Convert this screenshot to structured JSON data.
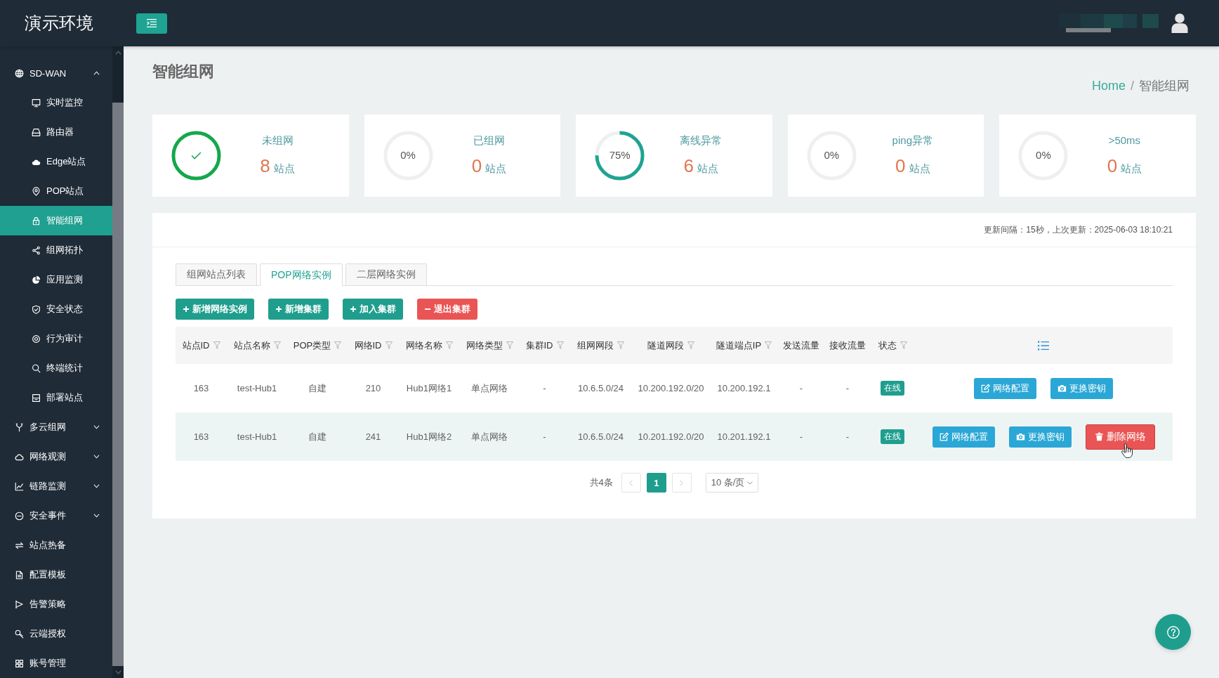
{
  "app": {
    "title": "演示环境"
  },
  "sidebar": {
    "items": [
      {
        "label": "SD-WAN",
        "selected": false,
        "expanded": true,
        "children": [
          {
            "label": "实时监控",
            "selected": false
          },
          {
            "label": "路由器",
            "selected": false
          },
          {
            "label": "Edge站点",
            "selected": false
          },
          {
            "label": "POP站点",
            "selected": false
          },
          {
            "label": "智能组网",
            "selected": true
          },
          {
            "label": "组网拓扑",
            "selected": false
          },
          {
            "label": "应用监测",
            "selected": false
          },
          {
            "label": "安全状态",
            "selected": false
          },
          {
            "label": "行为审计",
            "selected": false
          },
          {
            "label": "终端统计",
            "selected": false
          },
          {
            "label": "部署站点",
            "selected": false
          }
        ]
      },
      {
        "label": "多云组网",
        "selected": false,
        "expanded": false
      },
      {
        "label": "网络观测",
        "selected": false,
        "expanded": false
      },
      {
        "label": "链路监测",
        "selected": false,
        "expanded": false
      },
      {
        "label": "安全事件",
        "selected": false,
        "expanded": false
      },
      {
        "label": "站点热备",
        "selected": false
      },
      {
        "label": "配置模板",
        "selected": false
      },
      {
        "label": "告警策略",
        "selected": false
      },
      {
        "label": "云端授权",
        "selected": false
      },
      {
        "label": "账号管理",
        "selected": false
      }
    ]
  },
  "page": {
    "title": "智能组网",
    "breadcrumb": {
      "items": [
        "Home",
        "智能组网"
      ],
      "separator": "/"
    }
  },
  "stats": [
    {
      "label": "未组网",
      "count": "8",
      "unit": "站点",
      "success": true,
      "level": 1
    },
    {
      "label": "已组网",
      "count": "0",
      "unit": "站点",
      "success": false,
      "percent": "0%",
      "level": 0
    },
    {
      "label": "离线异常",
      "count": "6",
      "unit": "站点",
      "success": false,
      "percent": "75%",
      "level": 0.75
    },
    {
      "label": "ping异常",
      "count": "0",
      "unit": "站点",
      "success": false,
      "percent": "0%",
      "level": 0
    },
    {
      "label": ">50ms",
      "count": "0",
      "unit": "站点",
      "success": false,
      "percent": "0%",
      "level": 0
    }
  ],
  "panel": {
    "update_info": "更新间隔：15秒，上次更新：2025-06-03 18:10:21",
    "tabs": [
      {
        "label": "组网站点列表",
        "selected": false
      },
      {
        "label": "POP网络实例",
        "selected": true
      },
      {
        "label": "二层网络实例",
        "selected": false
      }
    ],
    "toolbar": [
      {
        "label": "新增网络实例",
        "kind": "add"
      },
      {
        "label": "新增集群",
        "kind": "add"
      },
      {
        "label": "加入集群",
        "kind": "add"
      },
      {
        "label": "退出集群",
        "kind": "remove"
      }
    ],
    "table": {
      "columns": [
        {
          "label": "站点ID",
          "filter": true
        },
        {
          "label": "站点名称",
          "filter": true
        },
        {
          "label": "POP类型",
          "filter": true
        },
        {
          "label": "网络ID",
          "filter": true
        },
        {
          "label": "网络名称",
          "filter": true
        },
        {
          "label": "网络类型",
          "filter": true
        },
        {
          "label": "集群ID",
          "filter": true
        },
        {
          "label": "组网网段",
          "filter": true
        },
        {
          "label": "隧道网段",
          "filter": true
        },
        {
          "label": "隧道端点IP",
          "filter": true
        },
        {
          "label": "发送流量",
          "filter": false
        },
        {
          "label": "接收流量",
          "filter": false
        },
        {
          "label": "状态",
          "filter": true
        }
      ],
      "rows": [
        {
          "hovered": false,
          "cells": [
            "163",
            "test-Hub1",
            "自建",
            "210",
            "Hub1网络1",
            "单点网络",
            "-",
            "10.6.5.0/24",
            "10.200.192.0/20",
            "10.200.192.1",
            "-",
            "-"
          ],
          "status": "在线",
          "actions": [
            {
              "label": "网络配置",
              "kind": "config",
              "hovered": false
            },
            {
              "label": "更换密钥",
              "kind": "key",
              "hovered": false
            }
          ]
        },
        {
          "hovered": true,
          "cells": [
            "163",
            "test-Hub1",
            "自建",
            "241",
            "Hub1网络2",
            "单点网络",
            "-",
            "10.6.5.0/24",
            "10.201.192.0/20",
            "10.201.192.1",
            "-",
            "-"
          ],
          "status": "在线",
          "actions": [
            {
              "label": "网络配置",
              "kind": "config",
              "hovered": false
            },
            {
              "label": "更换密钥",
              "kind": "key",
              "hovered": false
            },
            {
              "label": "删除网络",
              "kind": "delete",
              "hovered": true
            }
          ]
        }
      ]
    },
    "pagination": {
      "total": "共4条",
      "pages": [
        {
          "label": "1",
          "selected": true
        }
      ],
      "page_size": "10 条/页"
    }
  }
}
